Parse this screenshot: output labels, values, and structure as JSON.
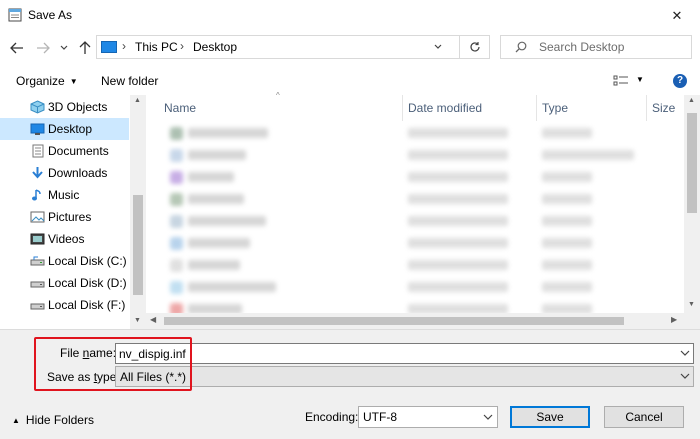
{
  "window": {
    "title": "Save As",
    "close_glyph": "✕"
  },
  "nav": {
    "back_icon": "arrow-left-icon",
    "forward_icon": "arrow-right-icon",
    "up_icon": "arrow-up-icon",
    "refresh_icon": "refresh-icon",
    "breadcrumb": [
      "This PC",
      "Desktop"
    ],
    "search_placeholder": "Search Desktop"
  },
  "toolbar": {
    "organize_label": "Organize",
    "new_folder_label": "New folder",
    "help_label": "?"
  },
  "sidebar": {
    "items": [
      {
        "label": "3D Objects",
        "icon": "cube-icon",
        "selected": false
      },
      {
        "label": "Desktop",
        "icon": "desktop-icon",
        "selected": true
      },
      {
        "label": "Documents",
        "icon": "document-icon",
        "selected": false
      },
      {
        "label": "Downloads",
        "icon": "download-icon",
        "selected": false
      },
      {
        "label": "Music",
        "icon": "music-icon",
        "selected": false
      },
      {
        "label": "Pictures",
        "icon": "pictures-icon",
        "selected": false
      },
      {
        "label": "Videos",
        "icon": "video-icon",
        "selected": false
      },
      {
        "label": "Local Disk (C:)",
        "icon": "drive-icon",
        "selected": false
      },
      {
        "label": "Local Disk (D:)",
        "icon": "drive-icon",
        "selected": false
      },
      {
        "label": "Local Disk (F:)",
        "icon": "drive-icon",
        "selected": false
      }
    ]
  },
  "file_list": {
    "columns": [
      "Name",
      "Date modified",
      "Type",
      "Size"
    ],
    "rows_blurred": true
  },
  "form": {
    "file_name_label": "File name:",
    "file_name_value": "nv_dispig.inf",
    "save_type_label": "Save as type:",
    "save_type_value": "All Files  (*.*)"
  },
  "footer": {
    "hide_folders_label": "Hide Folders",
    "encoding_label": "Encoding:",
    "encoding_value": "UTF-8",
    "save_label": "Save",
    "cancel_label": "Cancel"
  },
  "colors": {
    "accent": "#0078d7",
    "selection": "#cce8ff",
    "highlight_box": "#e0141e"
  }
}
